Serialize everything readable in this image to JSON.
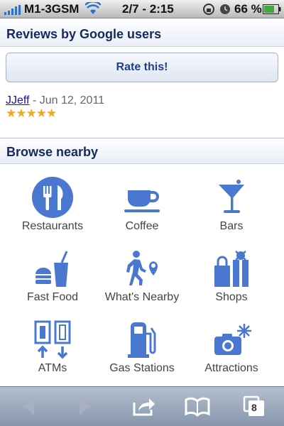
{
  "status": {
    "carrier": "M1-3GSM",
    "time": "2/7 - 2:15",
    "battery": "66 %"
  },
  "reviews": {
    "title": "Reviews by Google users",
    "rate_label": "Rate this!",
    "entry": {
      "author": "JJeff",
      "separator": " - ",
      "date": "Jun 12, 2011",
      "rating": 5,
      "stars": "★★★★★"
    }
  },
  "browse": {
    "title": "Browse nearby",
    "items": [
      {
        "label": "Restaurants",
        "icon": "fork-knife-icon"
      },
      {
        "label": "Coffee",
        "icon": "coffee-cup-icon"
      },
      {
        "label": "Bars",
        "icon": "cocktail-icon"
      },
      {
        "label": "Fast Food",
        "icon": "burger-drink-icon"
      },
      {
        "label": "What's Nearby",
        "icon": "walking-person-pin-icon"
      },
      {
        "label": "Shops",
        "icon": "shopping-bags-icon"
      },
      {
        "label": "ATMs",
        "icon": "atm-icon"
      },
      {
        "label": "Gas Stations",
        "icon": "gas-pump-icon"
      },
      {
        "label": "Attractions",
        "icon": "camera-icon"
      }
    ]
  },
  "toolbar": {
    "tabs_count": "8"
  },
  "colors": {
    "icon_blue": "#4a78d0",
    "header_text": "#15295a",
    "star": "#f5a623"
  }
}
